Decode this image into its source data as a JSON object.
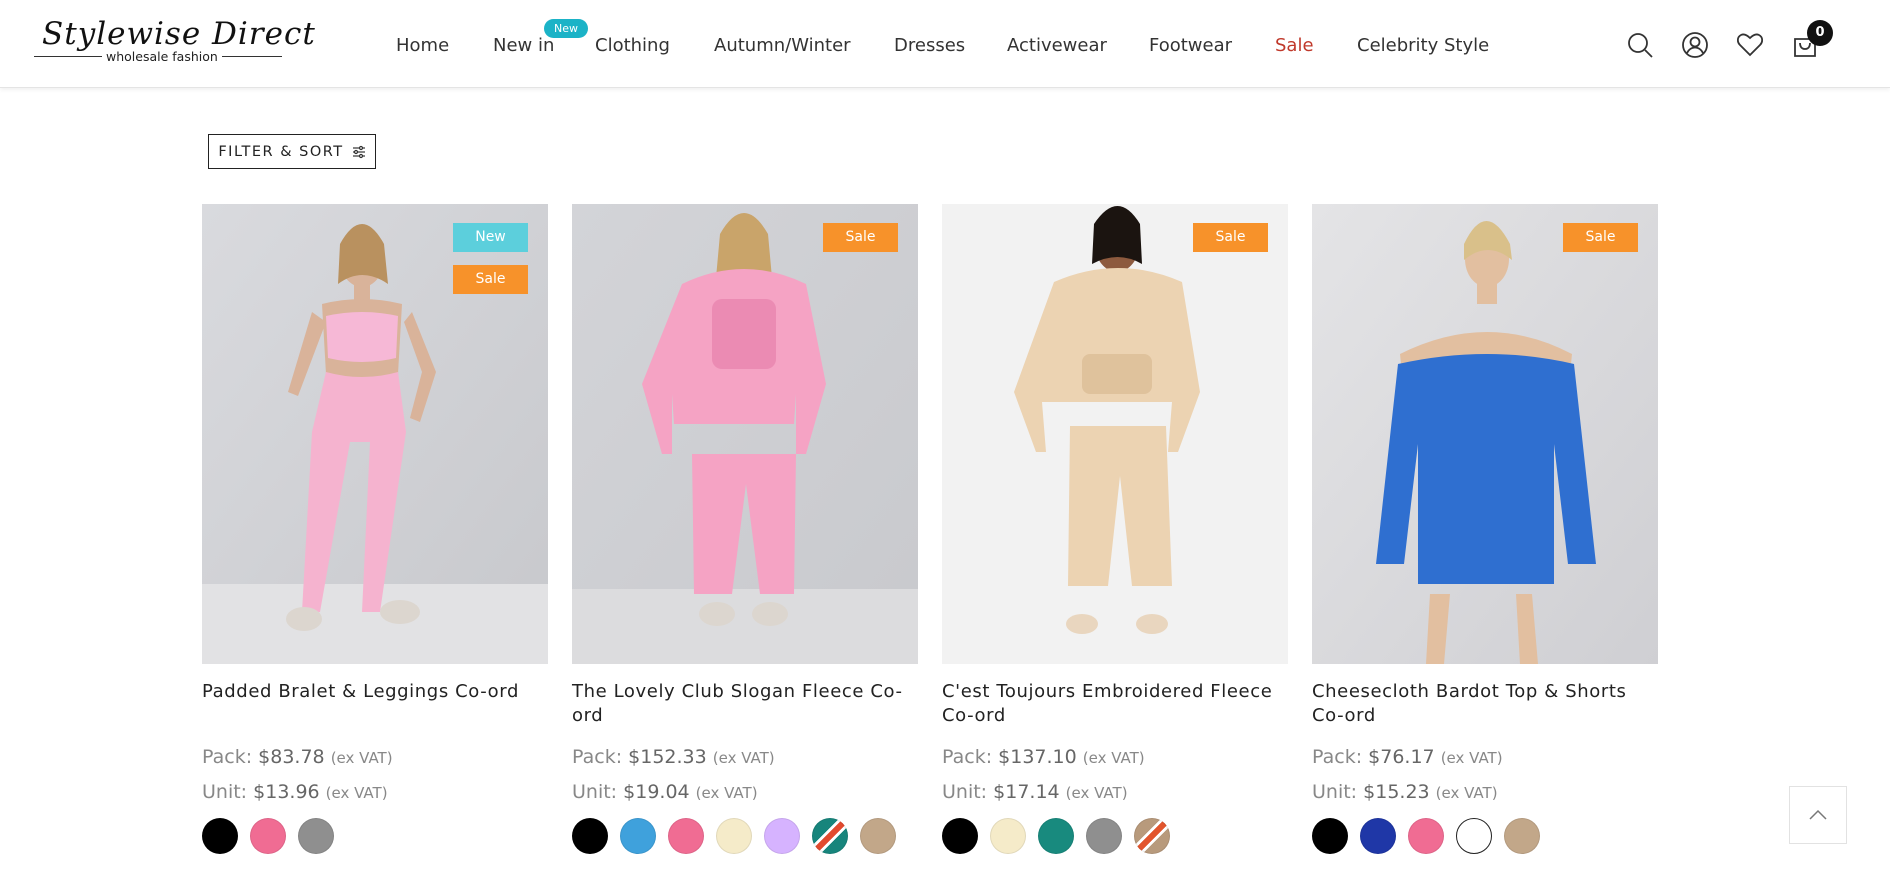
{
  "brand": {
    "name": "Stylewise Direct",
    "tagline": "wholesale fashion"
  },
  "nav": {
    "items": [
      "Home",
      "New in",
      "Clothing",
      "Autumn/Winter",
      "Dresses",
      "Activewear",
      "Footwear",
      "Sale",
      "Celebrity Style"
    ],
    "new_badge": "New",
    "sale_color": "#c0392b"
  },
  "header_icons": [
    "search-icon",
    "account-icon",
    "wishlist-heart-icon",
    "cart-bag-icon"
  ],
  "cart": {
    "count": "0"
  },
  "filter": {
    "label": "FILTER & SORT",
    "icon": "sliders-icon"
  },
  "colors": {
    "badge_new": "#5ccfdc",
    "badge_sale": "#f7922a"
  },
  "products": [
    {
      "title": "Padded Bralet & Leggings Co-ord",
      "badges": [
        "New",
        "Sale"
      ],
      "pack_label": "Pack:",
      "pack_price": "$83.78",
      "unit_label": "Unit:",
      "unit_price": "$13.96",
      "vat": "(ex VAT)",
      "swatches": [
        "#000000",
        "#f06c93",
        "#8f8f8f"
      ]
    },
    {
      "title": "The Lovely Club Slogan Fleece Co-ord",
      "badges": [
        "Sale"
      ],
      "pack_label": "Pack:",
      "pack_price": "$152.33",
      "unit_label": "Unit:",
      "unit_price": "$19.04",
      "vat": "(ex VAT)",
      "swatches": [
        "#000000",
        "#3fa1dc",
        "#f06c93",
        "#f5ebc9",
        "#d6b3ff",
        "stripe:#17857c:#e24a2e",
        "#c2a789"
      ]
    },
    {
      "title": "C'est Toujours Embroidered Fleece Co-ord",
      "badges": [
        "Sale"
      ],
      "pack_label": "Pack:",
      "pack_price": "$137.10",
      "unit_label": "Unit:",
      "unit_price": "$17.14",
      "vat": "(ex VAT)",
      "swatches": [
        "#000000",
        "#f5ebc9",
        "#188a7e",
        "#8f8f8f",
        "stripe:#b89a7c:#e2552d"
      ]
    },
    {
      "title": "Cheesecloth Bardot Top & Shorts Co-ord",
      "badges": [
        "Sale"
      ],
      "pack_label": "Pack:",
      "pack_price": "$76.17",
      "unit_label": "Unit:",
      "unit_price": "$15.23",
      "vat": "(ex VAT)",
      "swatches": [
        "#000000",
        "#1f37a7",
        "#f06c93",
        "#ffffff",
        "#c2a789"
      ]
    }
  ]
}
